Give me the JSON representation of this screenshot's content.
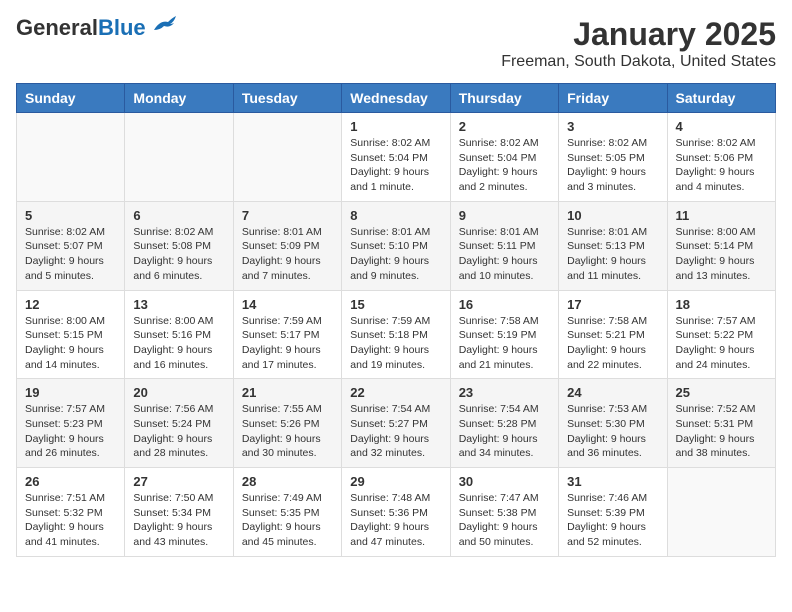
{
  "header": {
    "logo_general": "General",
    "logo_blue": "Blue",
    "title": "January 2025",
    "subtitle": "Freeman, South Dakota, United States"
  },
  "days_of_week": [
    "Sunday",
    "Monday",
    "Tuesday",
    "Wednesday",
    "Thursday",
    "Friday",
    "Saturday"
  ],
  "weeks": [
    {
      "days": [
        {
          "number": "",
          "info": ""
        },
        {
          "number": "",
          "info": ""
        },
        {
          "number": "",
          "info": ""
        },
        {
          "number": "1",
          "info": "Sunrise: 8:02 AM\nSunset: 5:04 PM\nDaylight: 9 hours and 1 minute."
        },
        {
          "number": "2",
          "info": "Sunrise: 8:02 AM\nSunset: 5:04 PM\nDaylight: 9 hours and 2 minutes."
        },
        {
          "number": "3",
          "info": "Sunrise: 8:02 AM\nSunset: 5:05 PM\nDaylight: 9 hours and 3 minutes."
        },
        {
          "number": "4",
          "info": "Sunrise: 8:02 AM\nSunset: 5:06 PM\nDaylight: 9 hours and 4 minutes."
        }
      ]
    },
    {
      "days": [
        {
          "number": "5",
          "info": "Sunrise: 8:02 AM\nSunset: 5:07 PM\nDaylight: 9 hours and 5 minutes."
        },
        {
          "number": "6",
          "info": "Sunrise: 8:02 AM\nSunset: 5:08 PM\nDaylight: 9 hours and 6 minutes."
        },
        {
          "number": "7",
          "info": "Sunrise: 8:01 AM\nSunset: 5:09 PM\nDaylight: 9 hours and 7 minutes."
        },
        {
          "number": "8",
          "info": "Sunrise: 8:01 AM\nSunset: 5:10 PM\nDaylight: 9 hours and 9 minutes."
        },
        {
          "number": "9",
          "info": "Sunrise: 8:01 AM\nSunset: 5:11 PM\nDaylight: 9 hours and 10 minutes."
        },
        {
          "number": "10",
          "info": "Sunrise: 8:01 AM\nSunset: 5:13 PM\nDaylight: 9 hours and 11 minutes."
        },
        {
          "number": "11",
          "info": "Sunrise: 8:00 AM\nSunset: 5:14 PM\nDaylight: 9 hours and 13 minutes."
        }
      ]
    },
    {
      "days": [
        {
          "number": "12",
          "info": "Sunrise: 8:00 AM\nSunset: 5:15 PM\nDaylight: 9 hours and 14 minutes."
        },
        {
          "number": "13",
          "info": "Sunrise: 8:00 AM\nSunset: 5:16 PM\nDaylight: 9 hours and 16 minutes."
        },
        {
          "number": "14",
          "info": "Sunrise: 7:59 AM\nSunset: 5:17 PM\nDaylight: 9 hours and 17 minutes."
        },
        {
          "number": "15",
          "info": "Sunrise: 7:59 AM\nSunset: 5:18 PM\nDaylight: 9 hours and 19 minutes."
        },
        {
          "number": "16",
          "info": "Sunrise: 7:58 AM\nSunset: 5:19 PM\nDaylight: 9 hours and 21 minutes."
        },
        {
          "number": "17",
          "info": "Sunrise: 7:58 AM\nSunset: 5:21 PM\nDaylight: 9 hours and 22 minutes."
        },
        {
          "number": "18",
          "info": "Sunrise: 7:57 AM\nSunset: 5:22 PM\nDaylight: 9 hours and 24 minutes."
        }
      ]
    },
    {
      "days": [
        {
          "number": "19",
          "info": "Sunrise: 7:57 AM\nSunset: 5:23 PM\nDaylight: 9 hours and 26 minutes."
        },
        {
          "number": "20",
          "info": "Sunrise: 7:56 AM\nSunset: 5:24 PM\nDaylight: 9 hours and 28 minutes."
        },
        {
          "number": "21",
          "info": "Sunrise: 7:55 AM\nSunset: 5:26 PM\nDaylight: 9 hours and 30 minutes."
        },
        {
          "number": "22",
          "info": "Sunrise: 7:54 AM\nSunset: 5:27 PM\nDaylight: 9 hours and 32 minutes."
        },
        {
          "number": "23",
          "info": "Sunrise: 7:54 AM\nSunset: 5:28 PM\nDaylight: 9 hours and 34 minutes."
        },
        {
          "number": "24",
          "info": "Sunrise: 7:53 AM\nSunset: 5:30 PM\nDaylight: 9 hours and 36 minutes."
        },
        {
          "number": "25",
          "info": "Sunrise: 7:52 AM\nSunset: 5:31 PM\nDaylight: 9 hours and 38 minutes."
        }
      ]
    },
    {
      "days": [
        {
          "number": "26",
          "info": "Sunrise: 7:51 AM\nSunset: 5:32 PM\nDaylight: 9 hours and 41 minutes."
        },
        {
          "number": "27",
          "info": "Sunrise: 7:50 AM\nSunset: 5:34 PM\nDaylight: 9 hours and 43 minutes."
        },
        {
          "number": "28",
          "info": "Sunrise: 7:49 AM\nSunset: 5:35 PM\nDaylight: 9 hours and 45 minutes."
        },
        {
          "number": "29",
          "info": "Sunrise: 7:48 AM\nSunset: 5:36 PM\nDaylight: 9 hours and 47 minutes."
        },
        {
          "number": "30",
          "info": "Sunrise: 7:47 AM\nSunset: 5:38 PM\nDaylight: 9 hours and 50 minutes."
        },
        {
          "number": "31",
          "info": "Sunrise: 7:46 AM\nSunset: 5:39 PM\nDaylight: 9 hours and 52 minutes."
        },
        {
          "number": "",
          "info": ""
        }
      ]
    }
  ]
}
